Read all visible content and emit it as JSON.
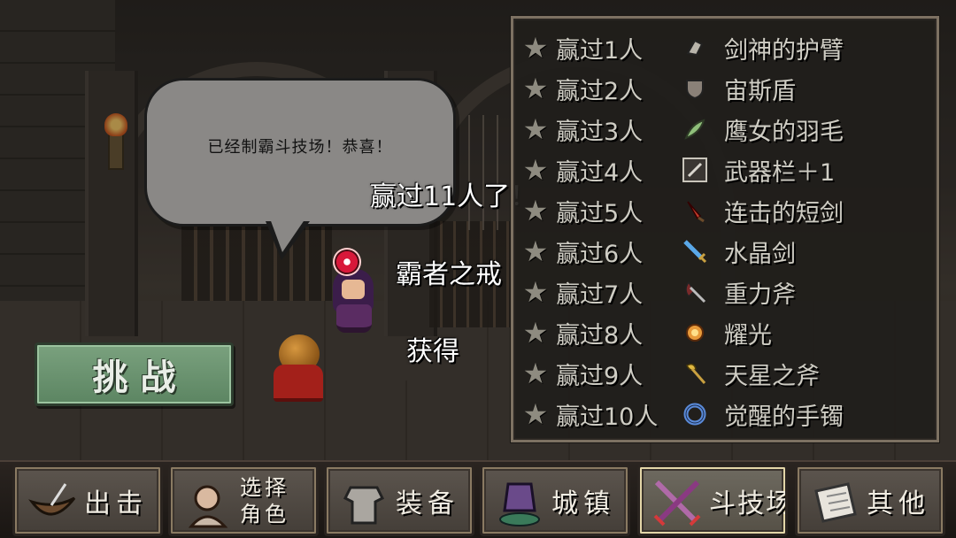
{
  "speech_bubble": {
    "text": "已经制霸斗技场！恭喜！"
  },
  "floating_texts": {
    "win_count": "赢过11人了！",
    "ring": "霸者之戒",
    "obtained": "获得"
  },
  "challenge_button": {
    "label": "挑战"
  },
  "rewards": [
    {
      "win": "赢过1人",
      "item": "剑神的护臂",
      "icon": "armguard-icon"
    },
    {
      "win": "赢过2人",
      "item": "宙斯盾",
      "icon": "shield-icon"
    },
    {
      "win": "赢过3人",
      "item": "鹰女的羽毛",
      "icon": "feather-icon"
    },
    {
      "win": "赢过4人",
      "item": "武器栏＋1",
      "icon": "weapon-slot-icon"
    },
    {
      "win": "赢过5人",
      "item": "连击的短剑",
      "icon": "dagger-icon"
    },
    {
      "win": "赢过6人",
      "item": "水晶剑",
      "icon": "crystal-sword-icon"
    },
    {
      "win": "赢过7人",
      "item": "重力斧",
      "icon": "axe-icon"
    },
    {
      "win": "赢过8人",
      "item": "耀光",
      "icon": "shine-icon"
    },
    {
      "win": "赢过9人",
      "item": "天星之斧",
      "icon": "star-axe-icon"
    },
    {
      "win": "赢过10人",
      "item": "觉醒的手镯",
      "icon": "bracelet-icon"
    }
  ],
  "nav": {
    "sortie": "出击",
    "select_line1": "选择",
    "select_line2": "角色",
    "equip": "装备",
    "town": "城镇",
    "arena": "斗技场",
    "other": "其他"
  },
  "colors": {
    "panel_text": "#cfcdc4",
    "star": "#8e8b80",
    "challenge_green": "#6a9470",
    "active_border": "#e3d6a8"
  }
}
